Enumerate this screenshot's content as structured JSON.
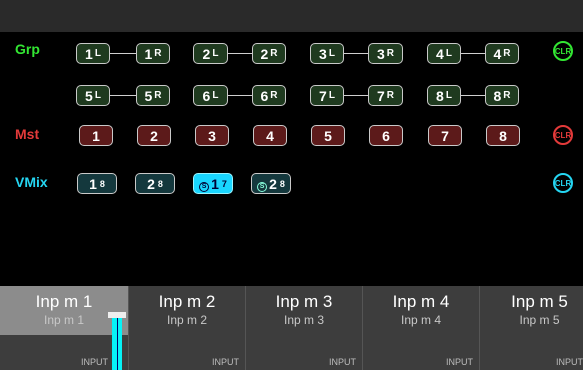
{
  "rows": {
    "grp": "Grp",
    "mst": "Mst",
    "vmix": "VMix"
  },
  "grp_buttons": [
    {
      "num": "1",
      "suf": "L"
    },
    {
      "num": "1",
      "suf": "R"
    },
    {
      "num": "2",
      "suf": "L"
    },
    {
      "num": "2",
      "suf": "R"
    },
    {
      "num": "3",
      "suf": "L"
    },
    {
      "num": "3",
      "suf": "R"
    },
    {
      "num": "4",
      "suf": "L"
    },
    {
      "num": "4",
      "suf": "R"
    },
    {
      "num": "5",
      "suf": "L"
    },
    {
      "num": "5",
      "suf": "R"
    },
    {
      "num": "6",
      "suf": "L"
    },
    {
      "num": "6",
      "suf": "R"
    },
    {
      "num": "7",
      "suf": "L"
    },
    {
      "num": "7",
      "suf": "R"
    },
    {
      "num": "8",
      "suf": "L"
    },
    {
      "num": "8",
      "suf": "R"
    }
  ],
  "mst_buttons": [
    "1",
    "2",
    "3",
    "4",
    "5",
    "6",
    "7",
    "8"
  ],
  "vmix_buttons": [
    {
      "num": "1",
      "sub": "8",
      "icon": false,
      "active": false
    },
    {
      "num": "2",
      "sub": "8",
      "icon": false,
      "active": false
    },
    {
      "num": "1",
      "sub": "7",
      "icon": true,
      "active": true
    },
    {
      "num": "2",
      "sub": "8",
      "icon": true,
      "active": false
    }
  ],
  "clear_label": "CLR",
  "colors": {
    "grp": "#33e633",
    "mst": "#e33a3a",
    "vmix": "#25d6f2",
    "vmix_active": "#19d6ff"
  },
  "channels": [
    {
      "name": "Inp m  1",
      "short": "Inp m  1",
      "type": "INPUT"
    },
    {
      "name": "Inp m  2",
      "short": "Inp m  2",
      "type": "INPUT"
    },
    {
      "name": "Inp m  3",
      "short": "Inp m  3",
      "type": "INPUT"
    },
    {
      "name": "Inp m  4",
      "short": "Inp m  4",
      "type": "INPUT"
    },
    {
      "name": "Inp m  5",
      "short": "Inp m  5",
      "type": "INPUT"
    }
  ]
}
